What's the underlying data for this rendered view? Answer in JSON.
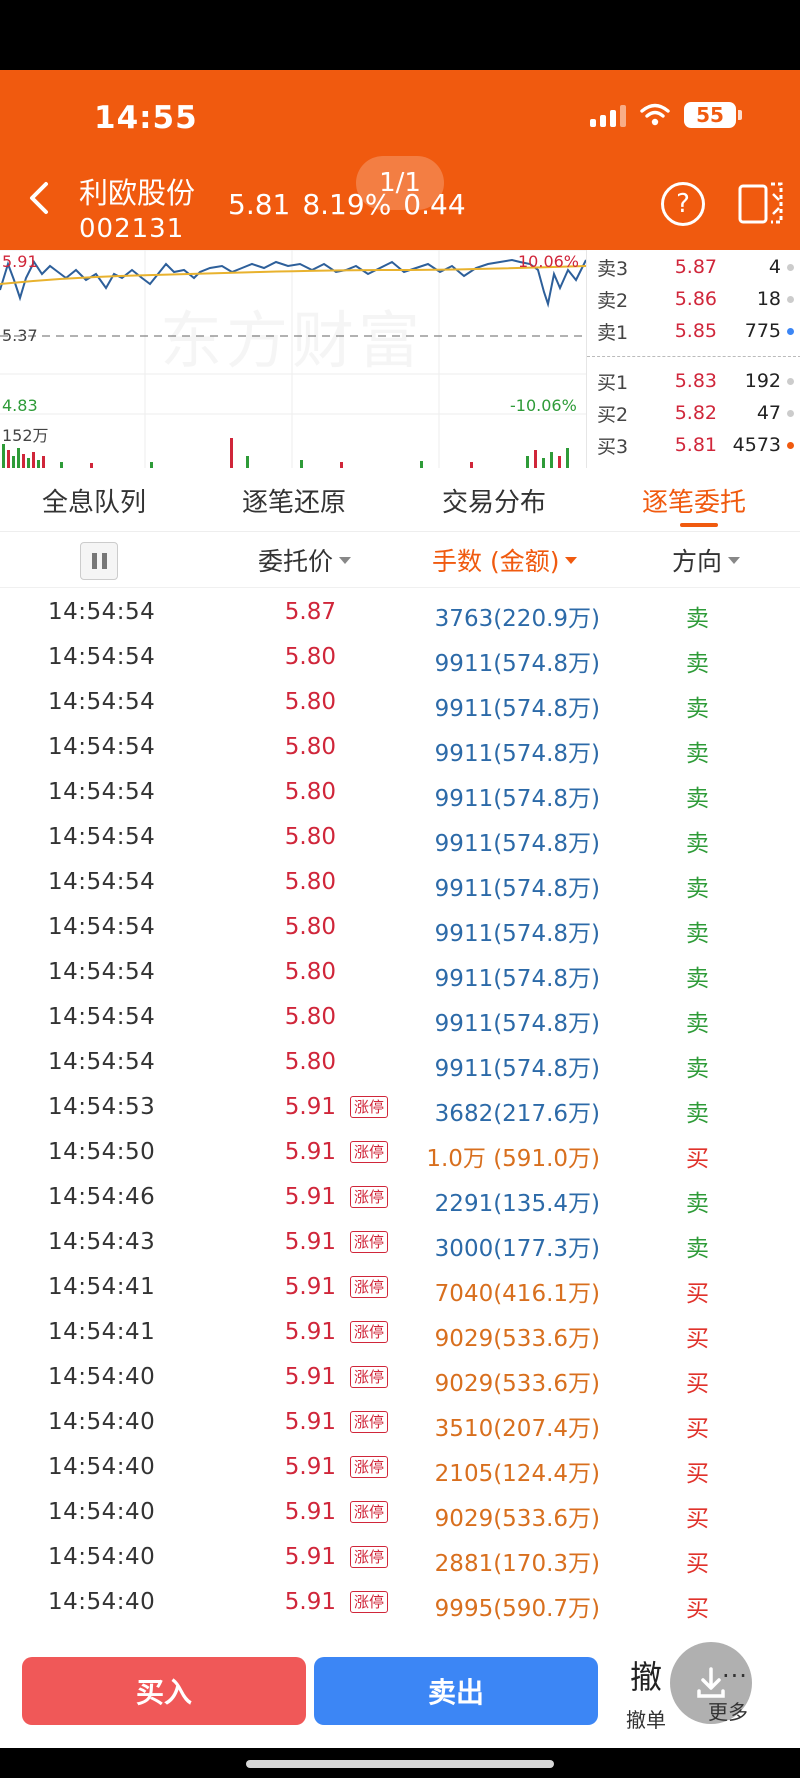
{
  "status_bar": {
    "time": "14:55",
    "battery": "55"
  },
  "header": {
    "stock_name": "利欧股份",
    "stock_code": "002131",
    "price": "5.81",
    "change_pct": "8.19%",
    "change_amt": "0.44",
    "page_indicator": "1/1"
  },
  "chart": {
    "watermark": "东方财富",
    "top_price": "5.91",
    "mid_price": "5.37",
    "low_price": "4.83",
    "top_pct": "10.06%",
    "low_pct": "-10.06%",
    "volume_label": "152万",
    "colors": {
      "price_line": "#2d5f9a",
      "avg_line": "#e8b22e",
      "up": "#d0263a",
      "down": "#2e9b38"
    }
  },
  "order_book": {
    "asks": [
      {
        "label": "卖3",
        "price": "5.87",
        "vol": "4"
      },
      {
        "label": "卖2",
        "price": "5.86",
        "vol": "18"
      },
      {
        "label": "卖1",
        "price": "5.85",
        "vol": "775"
      }
    ],
    "bids": [
      {
        "label": "买1",
        "price": "5.83",
        "vol": "192"
      },
      {
        "label": "买2",
        "price": "5.82",
        "vol": "47"
      },
      {
        "label": "买3",
        "price": "5.81",
        "vol": "4573"
      }
    ]
  },
  "tabs": [
    {
      "label": "全息队列"
    },
    {
      "label": "逐笔还原"
    },
    {
      "label": "交易分布"
    },
    {
      "label": "逐笔委托"
    }
  ],
  "columns": {
    "price": "委托价",
    "volume": "手数 (金额)",
    "direction": "方向"
  },
  "rows": [
    {
      "time": "14:54:54",
      "price": "5.87",
      "limit": "",
      "volume": "3763(220.9万)",
      "dir": "卖",
      "side": "sell"
    },
    {
      "time": "14:54:54",
      "price": "5.80",
      "limit": "",
      "volume": "9911(574.8万)",
      "dir": "卖",
      "side": "sell"
    },
    {
      "time": "14:54:54",
      "price": "5.80",
      "limit": "",
      "volume": "9911(574.8万)",
      "dir": "卖",
      "side": "sell"
    },
    {
      "time": "14:54:54",
      "price": "5.80",
      "limit": "",
      "volume": "9911(574.8万)",
      "dir": "卖",
      "side": "sell"
    },
    {
      "time": "14:54:54",
      "price": "5.80",
      "limit": "",
      "volume": "9911(574.8万)",
      "dir": "卖",
      "side": "sell"
    },
    {
      "time": "14:54:54",
      "price": "5.80",
      "limit": "",
      "volume": "9911(574.8万)",
      "dir": "卖",
      "side": "sell"
    },
    {
      "time": "14:54:54",
      "price": "5.80",
      "limit": "",
      "volume": "9911(574.8万)",
      "dir": "卖",
      "side": "sell"
    },
    {
      "time": "14:54:54",
      "price": "5.80",
      "limit": "",
      "volume": "9911(574.8万)",
      "dir": "卖",
      "side": "sell"
    },
    {
      "time": "14:54:54",
      "price": "5.80",
      "limit": "",
      "volume": "9911(574.8万)",
      "dir": "卖",
      "side": "sell"
    },
    {
      "time": "14:54:54",
      "price": "5.80",
      "limit": "",
      "volume": "9911(574.8万)",
      "dir": "卖",
      "side": "sell"
    },
    {
      "time": "14:54:54",
      "price": "5.80",
      "limit": "",
      "volume": "9911(574.8万)",
      "dir": "卖",
      "side": "sell"
    },
    {
      "time": "14:54:53",
      "price": "5.91",
      "limit": "涨停",
      "volume": "3682(217.6万)",
      "dir": "卖",
      "side": "sell"
    },
    {
      "time": "14:54:50",
      "price": "5.91",
      "limit": "涨停",
      "volume": "1.0万 (591.0万)",
      "dir": "买",
      "side": "buy"
    },
    {
      "time": "14:54:46",
      "price": "5.91",
      "limit": "涨停",
      "volume": "2291(135.4万)",
      "dir": "卖",
      "side": "sell"
    },
    {
      "time": "14:54:43",
      "price": "5.91",
      "limit": "涨停",
      "volume": "3000(177.3万)",
      "dir": "卖",
      "side": "sell"
    },
    {
      "time": "14:54:41",
      "price": "5.91",
      "limit": "涨停",
      "volume": "7040(416.1万)",
      "dir": "买",
      "side": "buy"
    },
    {
      "time": "14:54:41",
      "price": "5.91",
      "limit": "涨停",
      "volume": "9029(533.6万)",
      "dir": "买",
      "side": "buy"
    },
    {
      "time": "14:54:40",
      "price": "5.91",
      "limit": "涨停",
      "volume": "9029(533.6万)",
      "dir": "买",
      "side": "buy"
    },
    {
      "time": "14:54:40",
      "price": "5.91",
      "limit": "涨停",
      "volume": "3510(207.4万)",
      "dir": "买",
      "side": "buy"
    },
    {
      "time": "14:54:40",
      "price": "5.91",
      "limit": "涨停",
      "volume": "2105(124.4万)",
      "dir": "买",
      "side": "buy"
    },
    {
      "time": "14:54:40",
      "price": "5.91",
      "limit": "涨停",
      "volume": "9029(533.6万)",
      "dir": "买",
      "side": "buy"
    },
    {
      "time": "14:54:40",
      "price": "5.91",
      "limit": "涨停",
      "volume": "2881(170.3万)",
      "dir": "买",
      "side": "buy"
    },
    {
      "time": "14:54:40",
      "price": "5.91",
      "limit": "涨停",
      "volume": "9995(590.7万)",
      "dir": "买",
      "side": "buy"
    }
  ],
  "bottom_bar": {
    "buy_label": "买入",
    "sell_label": "卖出",
    "cancel_glyph": "撤",
    "cancel_label": "撤单",
    "more_label": "更多"
  }
}
